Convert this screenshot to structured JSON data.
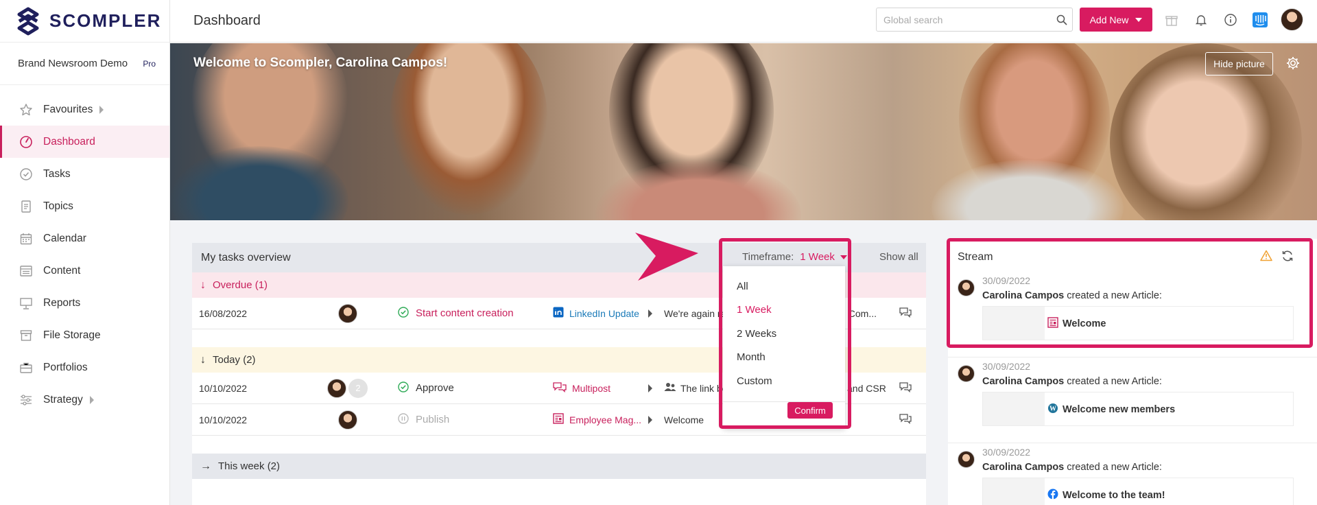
{
  "brand": {
    "name": "SCOMPLER",
    "accent": "#d81b60",
    "navy": "#1f1f5c"
  },
  "workspace": {
    "name": "Brand Newsroom Demo",
    "plan": "Pro"
  },
  "sidebar": {
    "items": [
      {
        "label": "Favourites",
        "icon": "star-icon"
      },
      {
        "label": "Dashboard",
        "icon": "dashboard-icon",
        "active": true
      },
      {
        "label": "Tasks",
        "icon": "check-circle-icon"
      },
      {
        "label": "Topics",
        "icon": "document-icon"
      },
      {
        "label": "Calendar",
        "icon": "calendar-icon"
      },
      {
        "label": "Content",
        "icon": "content-icon"
      },
      {
        "label": "Reports",
        "icon": "presentation-icon"
      },
      {
        "label": "File Storage",
        "icon": "archive-icon"
      },
      {
        "label": "Portfolios",
        "icon": "briefcase-icon"
      },
      {
        "label": "Strategy",
        "icon": "sliders-icon"
      }
    ]
  },
  "header": {
    "title": "Dashboard",
    "search_placeholder": "Global search",
    "add_new_label": "Add New"
  },
  "hero": {
    "welcome": "Welcome to Scompler, Carolina Campos!",
    "hide_picture_label": "Hide picture"
  },
  "tasks": {
    "title": "My tasks overview",
    "timeframe_label": "Timeframe:",
    "timeframe_value": "1 Week",
    "show_all_label": "Show all",
    "groups": {
      "overdue": "Overdue (1)",
      "today": "Today (2)",
      "this_week": "This week (2)"
    },
    "rows": [
      {
        "date": "16/08/2022",
        "task": "Start content creation",
        "channel": "LinkedIn Update",
        "desc": "We're again re",
        "desc2": "al Com..."
      },
      {
        "date": "10/10/2022",
        "extra_assignees": "2",
        "task": "Approve",
        "channel": "Multipost",
        "desc": "The link bet",
        "desc2": "and CSR"
      },
      {
        "date": "10/10/2022",
        "task": "Publish",
        "channel": "Employee Mag...",
        "desc": "Welcome"
      }
    ]
  },
  "timeframe_dropdown": {
    "options": [
      "All",
      "1 Week",
      "2 Weeks",
      "Month",
      "Custom"
    ],
    "selected": "1 Week",
    "confirm_label": "Confirm"
  },
  "stream": {
    "title": "Stream",
    "entries": [
      {
        "date": "30/09/2022",
        "user": "Carolina Campos",
        "action": "created a new Article:",
        "title": "Welcome",
        "icon": "magazine-icon"
      },
      {
        "date": "30/09/2022",
        "user": "Carolina Campos",
        "action": "created a new Article:",
        "title": "Welcome new members",
        "icon": "wordpress-icon"
      },
      {
        "date": "30/09/2022",
        "user": "Carolina Campos",
        "action": "created a new Article:",
        "title": "Welcome to the team!",
        "icon": "facebook-icon"
      }
    ]
  }
}
